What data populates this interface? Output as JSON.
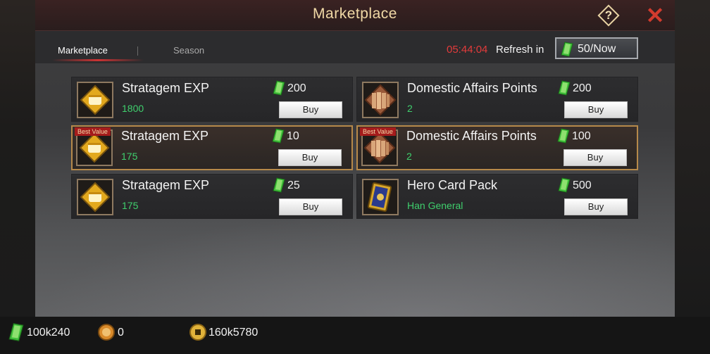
{
  "window": {
    "title": "Marketplace",
    "help_symbol": "?",
    "close_symbol": "✕"
  },
  "tabs": [
    {
      "label": "Marketplace",
      "active": true
    },
    {
      "label": "Season",
      "active": false
    }
  ],
  "refresh": {
    "timer": "05:44:04",
    "label": "Refresh in",
    "button_label": "50/Now"
  },
  "items": [
    {
      "name": "Stratagem EXP",
      "quantity": "1800",
      "price": "200",
      "buy_label": "Buy",
      "best_value": false,
      "icon": "fist-icon"
    },
    {
      "name": "Domestic Affairs Points",
      "quantity": "2",
      "price": "200",
      "buy_label": "Buy",
      "best_value": false,
      "icon": "scroll-bundle-icon"
    },
    {
      "name": "Stratagem EXP",
      "quantity": "175",
      "price": "10",
      "buy_label": "Buy",
      "best_value": true,
      "tag": "Best Value",
      "icon": "fist-icon"
    },
    {
      "name": "Domestic Affairs Points",
      "quantity": "2",
      "price": "100",
      "buy_label": "Buy",
      "best_value": true,
      "tag": "Best Value",
      "icon": "scroll-bundle-icon"
    },
    {
      "name": "Stratagem EXP",
      "quantity": "175",
      "price": "25",
      "buy_label": "Buy",
      "best_value": false,
      "icon": "fist-icon"
    },
    {
      "name": "Hero Card Pack",
      "quantity": "Han General",
      "price": "500",
      "buy_label": "Buy",
      "best_value": false,
      "icon": "card-pack-icon"
    }
  ],
  "resources": [
    {
      "name": "jade",
      "value": "100k240",
      "icon": "jade-icon"
    },
    {
      "name": "medal",
      "value": "0",
      "icon": "medal-icon"
    },
    {
      "name": "coin",
      "value": "160k5780",
      "icon": "coin-icon"
    }
  ],
  "colors": {
    "timer": "#e33b3b",
    "quantity": "#3fcf6d",
    "title": "#f1d9a6",
    "close": "#d23b2e",
    "best_value_border": "#b6894a"
  }
}
